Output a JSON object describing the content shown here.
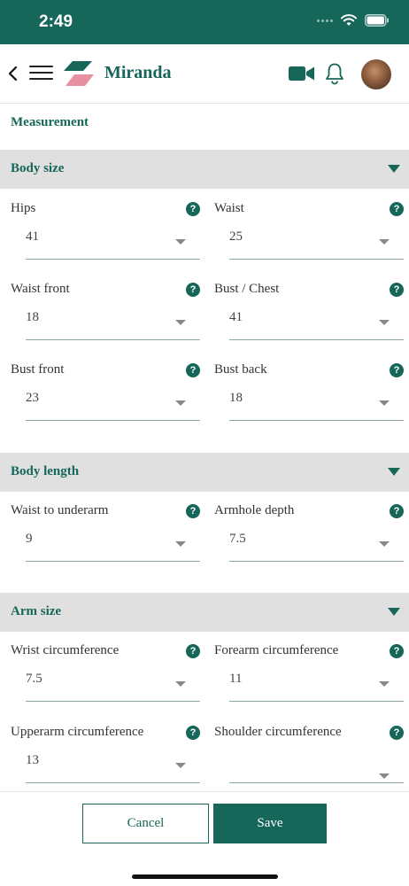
{
  "status_bar": {
    "time": "2:49"
  },
  "header": {
    "user_name": "Miranda"
  },
  "page_title": "Measurement",
  "sections": {
    "body_size": {
      "title": "Body size",
      "fields": [
        {
          "label": "Hips",
          "value": "41"
        },
        {
          "label": "Waist",
          "value": "25"
        },
        {
          "label": "Waist front",
          "value": "18"
        },
        {
          "label": "Bust / Chest",
          "value": "41"
        },
        {
          "label": "Bust front",
          "value": "23"
        },
        {
          "label": "Bust back",
          "value": "18"
        }
      ]
    },
    "body_length": {
      "title": "Body length",
      "fields": [
        {
          "label": "Waist to underarm",
          "value": "9"
        },
        {
          "label": "Armhole depth",
          "value": "7.5"
        }
      ]
    },
    "arm_size": {
      "title": "Arm size",
      "fields": [
        {
          "label": "Wrist circumference",
          "value": "7.5"
        },
        {
          "label": "Forearm circumference",
          "value": "11"
        },
        {
          "label": "Upperarm circumference",
          "value": "13"
        },
        {
          "label": "Shoulder circumference",
          "value": ""
        }
      ]
    }
  },
  "help_glyph": "?",
  "footer": {
    "cancel_label": "Cancel",
    "save_label": "Save"
  },
  "colors": {
    "brand": "#17665a",
    "section_bg": "#e0e0e0",
    "logo_pink": "#e88fa0"
  },
  "icons": [
    "back-icon",
    "menu-icon",
    "logo",
    "video-camera-icon",
    "bell-icon",
    "help-icon",
    "chevron-down-icon",
    "wifi-icon",
    "battery-icon"
  ]
}
